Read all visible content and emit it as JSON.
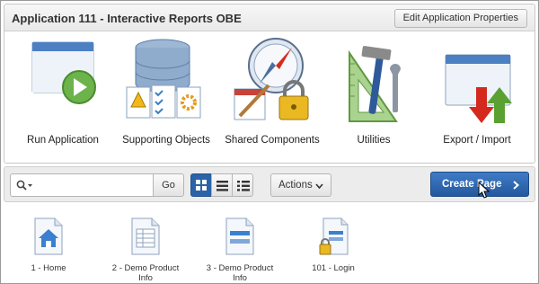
{
  "header": {
    "app_title": "Application 111 - Interactive Reports OBE",
    "edit_properties_label": "Edit Application Properties"
  },
  "tiles": [
    {
      "label": "Run Application",
      "icon": "run-application-icon"
    },
    {
      "label": "Supporting Objects",
      "icon": "supporting-objects-icon"
    },
    {
      "label": "Shared Components",
      "icon": "shared-components-icon"
    },
    {
      "label": "Utilities",
      "icon": "utilities-icon"
    },
    {
      "label": "Export / Import",
      "icon": "export-import-icon"
    }
  ],
  "toolbar": {
    "search_value": "",
    "go_label": "Go",
    "view_modes": [
      "icons",
      "details",
      "report"
    ],
    "active_view": "icons",
    "actions_label": "Actions",
    "create_page_label": "Create Page"
  },
  "pages": [
    {
      "label": "1 - Home",
      "icon": "home-page-icon"
    },
    {
      "label": "2 - Demo Product Info",
      "icon": "report-page-icon"
    },
    {
      "label": "3 - Demo Product Info",
      "icon": "form-page-icon"
    },
    {
      "label": "101 - Login",
      "icon": "login-page-icon"
    }
  ],
  "colors": {
    "accent": "#2c62a8",
    "create_button": "#23589e",
    "export_red": "#d42a1e",
    "import_green": "#5aa132"
  }
}
